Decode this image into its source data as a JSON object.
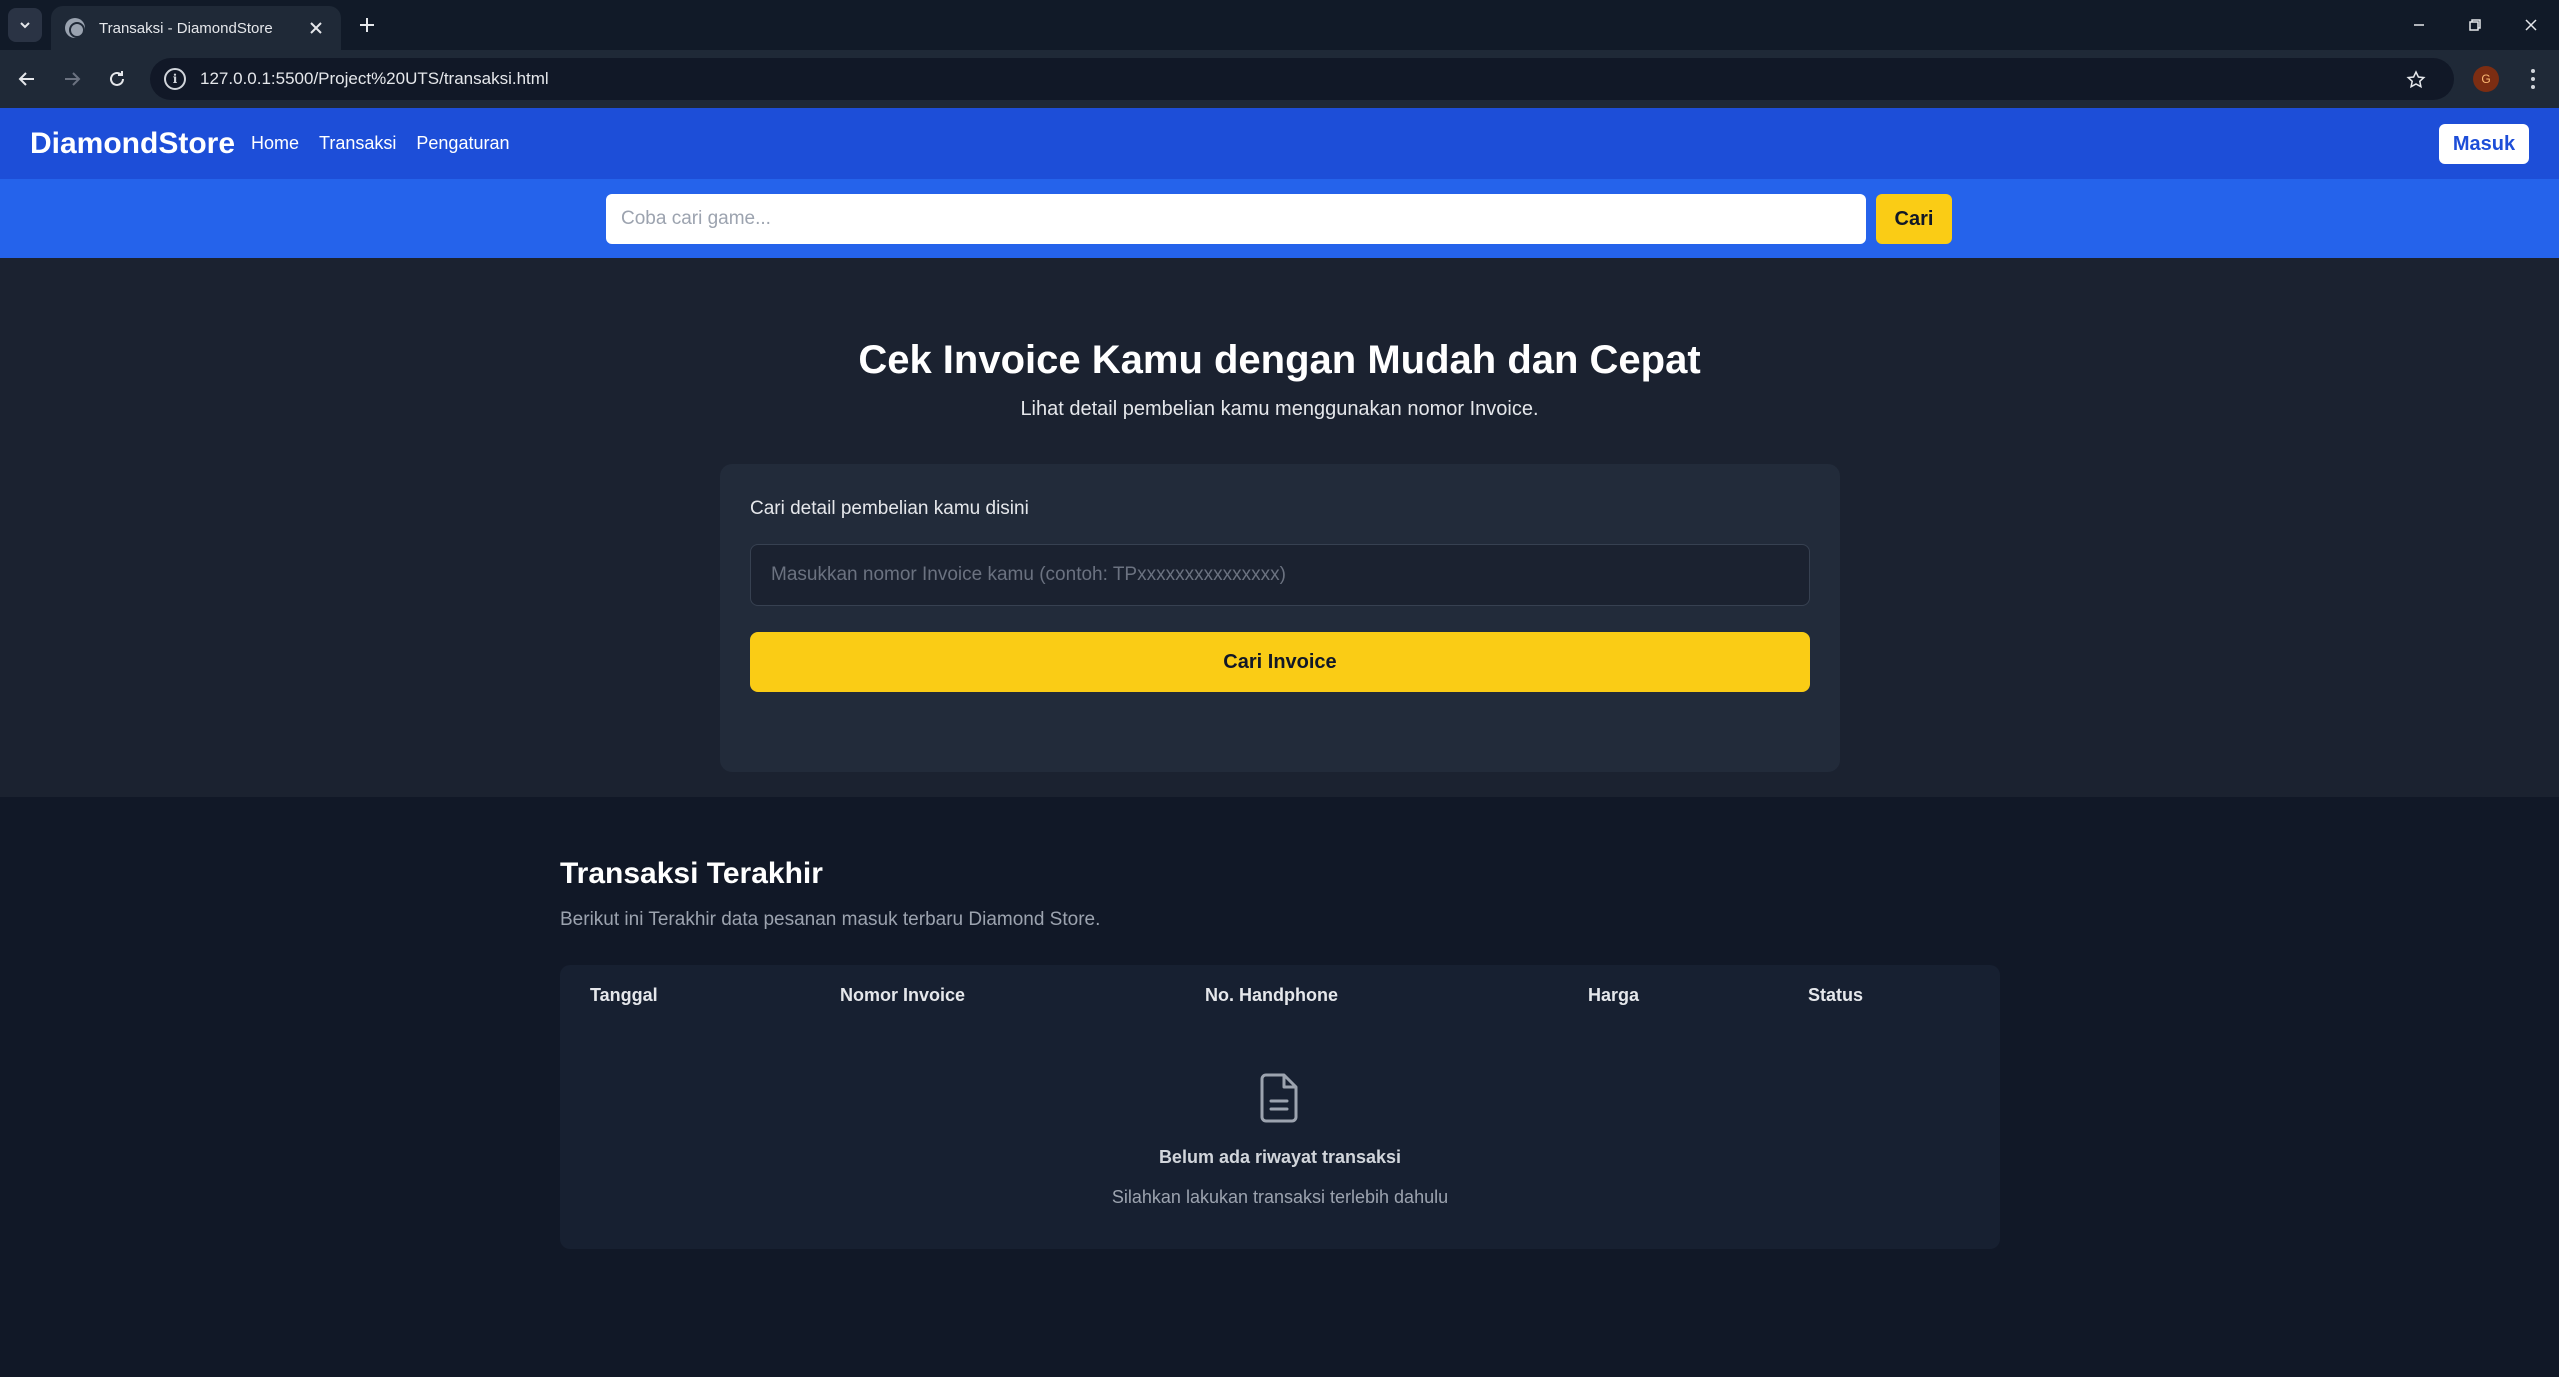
{
  "browser": {
    "tab_title": "Transaksi - DiamondStore",
    "url": "127.0.0.1:5500/Project%20UTS/transaksi.html",
    "profile_initial": "G"
  },
  "nav": {
    "brand": "DiamondStore",
    "links": [
      "Home",
      "Transaksi",
      "Pengaturan"
    ],
    "login_label": "Masuk"
  },
  "search": {
    "placeholder": "Coba cari game...",
    "button_label": "Cari"
  },
  "hero": {
    "title": "Cek Invoice Kamu dengan Mudah dan Cepat",
    "subtitle": "Lihat detail pembelian kamu menggunakan nomor Invoice.",
    "card_label": "Cari detail pembelian kamu disini",
    "input_placeholder": "Masukkan nomor Invoice kamu (contoh: TPxxxxxxxxxxxxxxx)",
    "button_label": "Cari Invoice"
  },
  "recent": {
    "title": "Transaksi Terakhir",
    "subtitle": "Berikut ini Terakhir data pesanan masuk terbaru Diamond Store.",
    "columns": [
      "Tanggal",
      "Nomor Invoice",
      "No. Handphone",
      "Harga",
      "Status"
    ],
    "empty_title": "Belum ada riwayat transaksi",
    "empty_subtitle": "Silahkan lakukan transaksi terlebih dahulu"
  },
  "colors": {
    "nav_bg": "#1d4ed8",
    "search_band_bg": "#2563eb",
    "accent_yellow": "#facc15",
    "page_bg": "#111827"
  },
  "icons": {
    "empty_state": "document-icon"
  }
}
